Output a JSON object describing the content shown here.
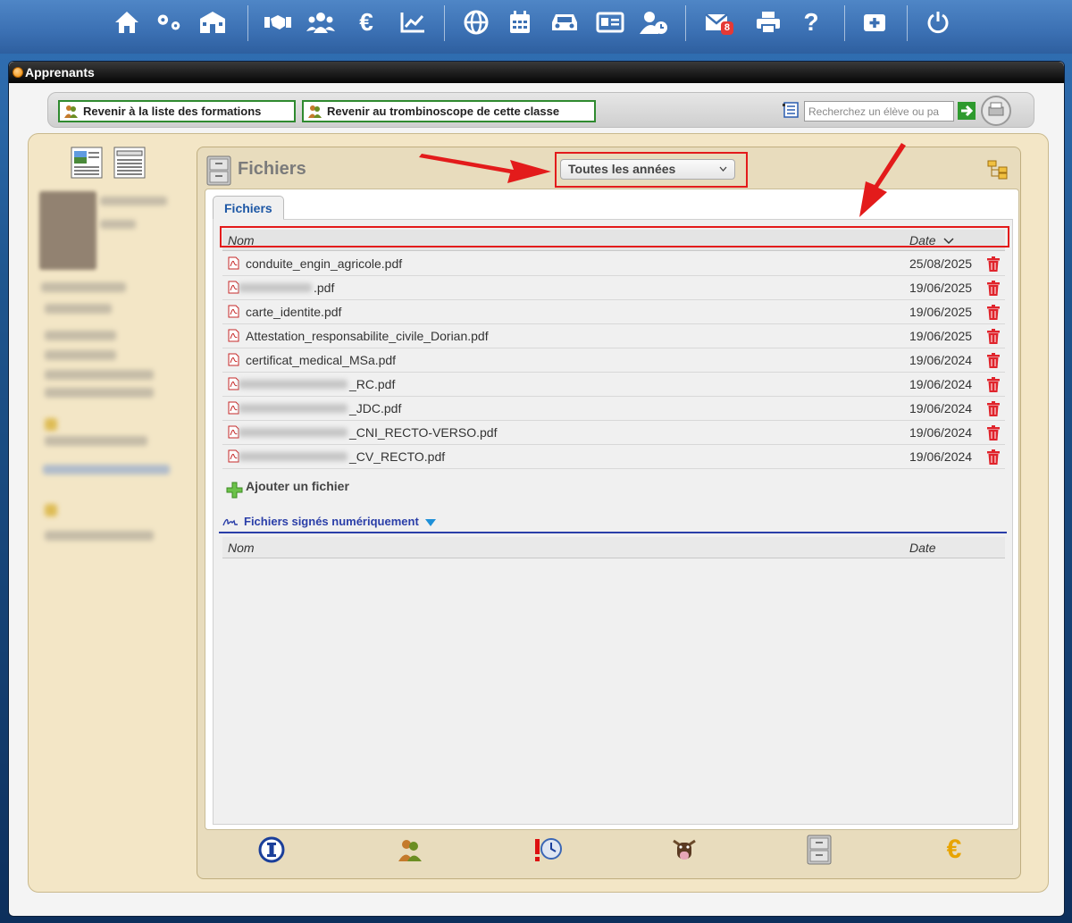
{
  "topbar": {
    "icons": [
      "home-icon",
      "settings-icon",
      "school-icon",
      "handshake-icon",
      "group-icon",
      "euro-icon",
      "chart-icon",
      "globe-icon",
      "calendar-icon",
      "car-icon",
      "id-card-icon",
      "user-clock-icon",
      "mail-icon",
      "print-icon",
      "help-icon",
      "first-aid-icon",
      "power-icon"
    ],
    "mail_badge": "8",
    "euro_label": "€",
    "help_label": "?"
  },
  "window": {
    "title": "Apprenants"
  },
  "toolbar": {
    "back_formations": "Revenir à la liste des formations",
    "back_trombi": "Revenir au trombinoscope de cette classe",
    "search_placeholder": "Recherchez un élève ou pa"
  },
  "files": {
    "panel_title": "Fichiers",
    "year_select": "Toutes les années",
    "tab_label": "Fichiers",
    "col_name": "Nom",
    "col_date": "Date",
    "rows": [
      {
        "name": "conduite_engin_agricole.pdf",
        "date": "25/08/2025"
      },
      {
        "name": ".pdf",
        "date": "19/06/2025"
      },
      {
        "name": "carte_identite.pdf",
        "date": "19/06/2025"
      },
      {
        "name": "Attestation_responsabilite_civile_Dorian.pdf",
        "date": "19/06/2025"
      },
      {
        "name": "certificat_medical_MSa.pdf",
        "date": "19/06/2024"
      },
      {
        "name": "_RC.pdf",
        "date": "19/06/2024"
      },
      {
        "name": "_JDC.pdf",
        "date": "19/06/2024"
      },
      {
        "name": "_CNI_RECTO-VERSO.pdf",
        "date": "19/06/2024"
      },
      {
        "name": "_CV_RECTO.pdf",
        "date": "19/06/2024"
      }
    ],
    "add_file": "Ajouter un fichier",
    "signed_title": "Fichiers signés numériquement",
    "signed_col_name": "Nom",
    "signed_col_date": "Date"
  },
  "bottom_icons": [
    "info-icon",
    "people-icon",
    "clock-alert-icon",
    "cow-icon",
    "cabinet-icon",
    "euro-icon"
  ],
  "bottom_euro": "€",
  "colors": {
    "accent_blue": "#1d57a5",
    "highlight_red": "#e31b1b",
    "trash_red": "#e0242c",
    "green_border": "#2f8a2f"
  }
}
